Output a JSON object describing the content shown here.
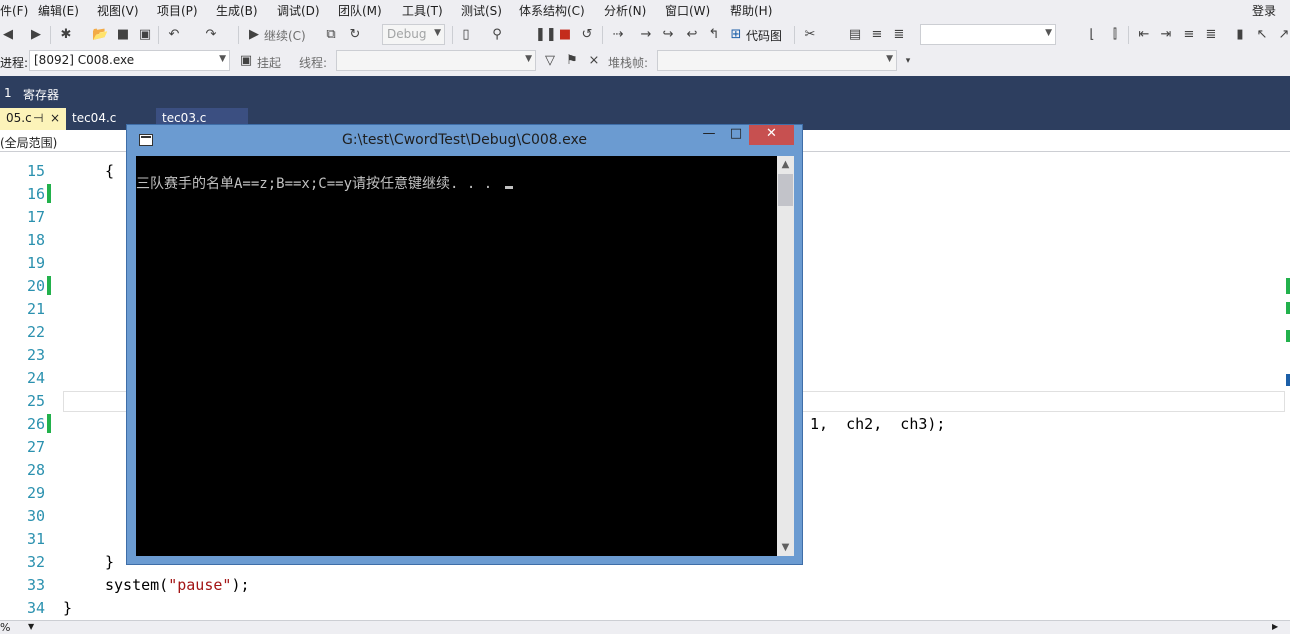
{
  "menubar": {
    "items": [
      "件(F)",
      "编辑(E)",
      "视图(V)",
      "项目(P)",
      "生成(B)",
      "调试(D)",
      "团队(M)",
      "工具(T)",
      "测试(S)",
      "体系结构(C)",
      "分析(N)",
      "窗口(W)",
      "帮助(H)"
    ],
    "login": "登录"
  },
  "toolbar1": {
    "continue_label": "继续(C)",
    "config_value": "Debug",
    "code_map_label": "代码图"
  },
  "toolbar2": {
    "process_label": "进程:",
    "process_value": "[8092] C008.exe",
    "suspend_label": "挂起",
    "thread_label": "线程:",
    "stack_frame_label": "堆栈帧:"
  },
  "darkband": {
    "left_num": "1",
    "registers_label": "寄存器"
  },
  "tabs": {
    "active_label": "05.c",
    "pin_glyph": "⊣",
    "close_glyph": "×",
    "tab2_label": "tec04.c",
    "tab3_label": "tec03.c"
  },
  "scopebar": {
    "scope_label": "(全局范围)"
  },
  "editor": {
    "line_numbers": [
      "15",
      "16",
      "17",
      "18",
      "19",
      "20",
      "21",
      "22",
      "23",
      "24",
      "25",
      "26",
      "27",
      "28",
      "29",
      "30",
      "31",
      "32",
      "33",
      "34"
    ],
    "line_15": "{",
    "line_26_tail": "1,  ch2,  ch3);",
    "line_32": "}",
    "line_33_pre": "system(",
    "line_33_str": "\"pause\"",
    "line_33_post": ");",
    "line_34": "}"
  },
  "console": {
    "title": "G:\\test\\CwordTest\\Debug\\C008.exe",
    "output": "三队赛手的名单A==z;B==x;C==y请按任意键继续. . . ",
    "minimize": "—",
    "maximize": "□",
    "close": "✕"
  },
  "bottombar": {
    "zoom": "%"
  },
  "colors": {
    "dark_band": "#2d3e5f",
    "active_tab": "#fcf3b9",
    "line_number": "#2b91af",
    "string": "#a31515",
    "change_mark": "#22b14c",
    "console_frame": "#6b9bd1",
    "close_button": "#c75050"
  }
}
